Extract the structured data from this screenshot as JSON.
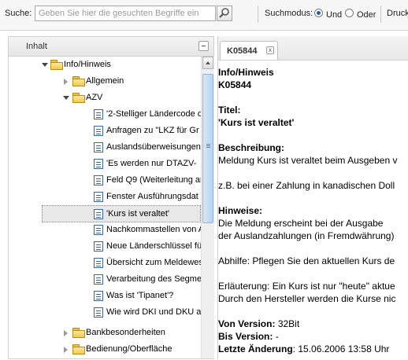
{
  "toolbar": {
    "search_label": "Suche:",
    "search_placeholder": "Geben Sie hier die gesuchten Begriffe ein",
    "mode_label": "Suchmodus:",
    "mode_und": "Und",
    "mode_oder": "Oder",
    "print_label": "Druck"
  },
  "left_panel": {
    "title": "Inhalt",
    "tree": [
      {
        "label": "Info/Hinweis"
      },
      {
        "label": "Allgemein"
      },
      {
        "label": "AZV"
      },
      {
        "label": "'2-Stelliger Ländercode d"
      },
      {
        "label": "Anfragen zu \"LKZ für Gr"
      },
      {
        "label": "Auslandsüberweisungen"
      },
      {
        "label": "'Es werden nur DTAZV-"
      },
      {
        "label": "Feld Q9 (Weiterleitung an"
      },
      {
        "label": "Fenster Ausführungsdat"
      },
      {
        "label": "'Kurs ist veraltet'"
      },
      {
        "label": "Nachkommastellen von A"
      },
      {
        "label": "Neue Länderschlüssel fü"
      },
      {
        "label": "Übersicht zum Meldewes"
      },
      {
        "label": "Verarbeitung des Segme"
      },
      {
        "label": "Was ist 'Tipanet'?"
      },
      {
        "label": "Wie wird DKI und DKU a"
      },
      {
        "label": "Bankbesonderheiten"
      },
      {
        "label": "Bedienung/Oberfläche"
      }
    ]
  },
  "right_panel": {
    "tab_label": "K05844",
    "tab_close": "x",
    "content": {
      "heading1": "Info/Hinweis",
      "heading2": "K05844",
      "titel_label": "Titel:",
      "titel_value": "'Kurs ist veraltet'",
      "beschreibung_label": "Beschreibung:",
      "beschreibung_text": "Meldung Kurs ist veraltet beim Ausgeben v",
      "beispiel_text": "z.B. bei einer Zahlung in kanadischen Doll",
      "hinweise_label": "Hinweise:",
      "hinweise_line1": "Die Meldung erscheint bei der Ausgabe",
      "hinweise_line2": "der Auslandzahlungen (in Fremdwährung)",
      "abhilfe_text": "Abhilfe: Pflegen Sie den aktuellen Kurs de",
      "erlaeuterung_line1": "Erläuterung: Ein Kurs ist nur \"heute\" aktue",
      "erlaeuterung_line2": "Durch den Hersteller werden die Kurse nic",
      "von_version_label": "Von Version:",
      "von_version_value": "32Bit",
      "bis_version_label": "Bis Version:",
      "bis_version_value": "-",
      "letzte_label": "Letzte Änderung",
      "letzte_value": ": 15.06.2006 13:58 Uhr"
    }
  }
}
